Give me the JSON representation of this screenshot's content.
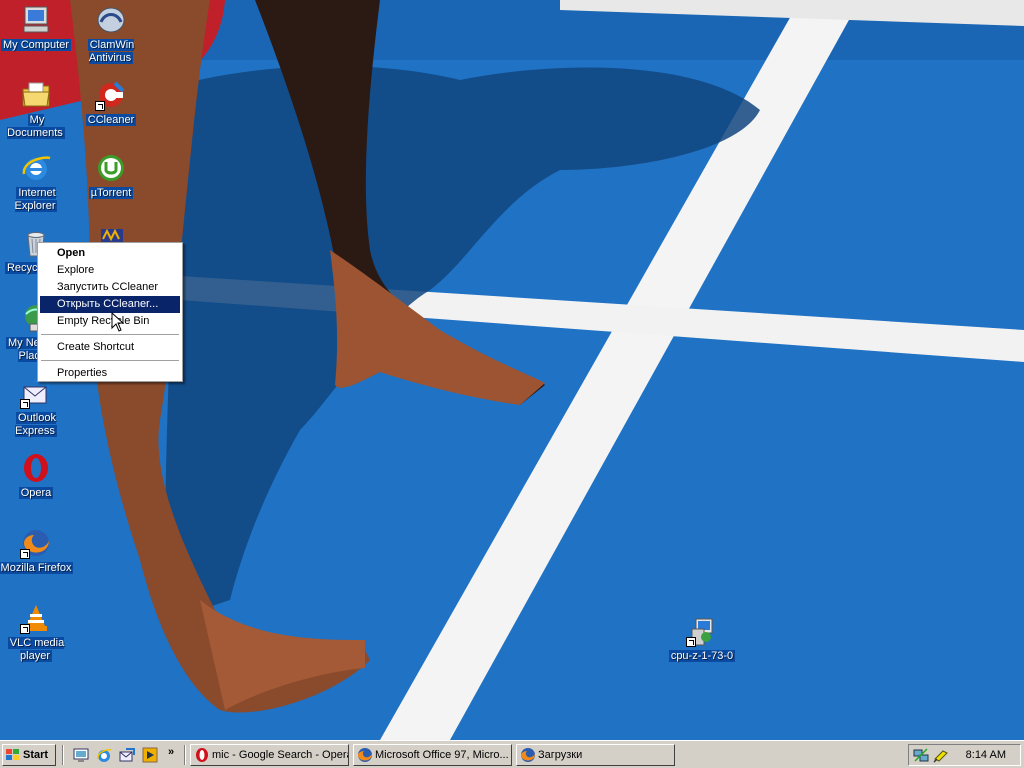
{
  "desktop": {
    "icons": [
      {
        "label": "My Computer",
        "icon": "my-computer-icon"
      },
      {
        "label": "ClamWin Antivirus",
        "icon": "clamwin-icon"
      },
      {
        "label": "My Documents",
        "icon": "my-documents-icon"
      },
      {
        "label": "CCleaner",
        "icon": "ccleaner-icon"
      },
      {
        "label": "Internet Explorer",
        "icon": "internet-explorer-icon"
      },
      {
        "label": "µTorrent",
        "icon": "utorrent-icon"
      },
      {
        "label": "Recycle Bin",
        "icon": "recycle-bin-icon"
      },
      {
        "label": "",
        "icon": "winamp-icon"
      },
      {
        "label": "My Network Places",
        "icon": "network-places-icon"
      },
      {
        "label": "Outlook Express",
        "icon": "outlook-express-icon"
      },
      {
        "label": "Opera",
        "icon": "opera-icon"
      },
      {
        "label": "Mozilla Firefox",
        "icon": "firefox-icon"
      },
      {
        "label": "VLC media player",
        "icon": "vlc-icon"
      },
      {
        "label": "cpu-z-1-73-0",
        "icon": "cpu-z-installer-icon"
      }
    ]
  },
  "context_menu": {
    "items": [
      {
        "label": "Open"
      },
      {
        "label": "Explore"
      },
      {
        "label": "Запустить CCleaner"
      },
      {
        "label": "Открыть CCleaner..."
      },
      {
        "label": "Empty Recycle Bin"
      },
      {
        "label": "Create Shortcut"
      },
      {
        "label": "Properties"
      }
    ],
    "highlighted": "Открыть CCleaner..."
  },
  "taskbar": {
    "start_label": "Start",
    "quick_launch_icons": [
      "show-desktop-icon",
      "internet-explorer-icon",
      "outlook-express-icon",
      "media-player-icon"
    ],
    "chevron": "»",
    "tasks": [
      {
        "label": "mic - Google Search - Opera",
        "icon": "opera-icon"
      },
      {
        "label": "Microsoft Office 97, Micro...",
        "icon": "firefox-icon"
      },
      {
        "label": "Загрузки",
        "icon": "firefox-icon"
      }
    ],
    "tray_icons": [
      "network-icon",
      "power-icon"
    ],
    "clock": "8:14 AM"
  },
  "colors": {
    "track_blue": "#1f72c4",
    "selection_blue": "#0a246a",
    "taskbar_gray": "#d4d0c8"
  }
}
